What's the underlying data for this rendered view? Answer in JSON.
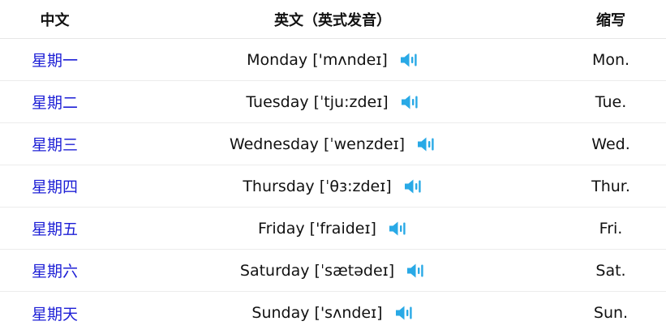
{
  "headers": {
    "chinese": "中文",
    "english": "英文（英式发音）",
    "abbreviation": "缩写"
  },
  "rows": [
    {
      "chinese": "星期一",
      "english": "Monday ['mʌndeɪ]",
      "abbr": "Mon."
    },
    {
      "chinese": "星期二",
      "english": "Tuesday [ˈtju:zdeɪ]",
      "abbr": "Tue."
    },
    {
      "chinese": "星期三",
      "english": "Wednesday [ˈwenzdeɪ]",
      "abbr": "Wed."
    },
    {
      "chinese": "星期四",
      "english": "Thursday [ˈθɜ:zdeɪ]",
      "abbr": "Thur."
    },
    {
      "chinese": "星期五",
      "english": "Friday ['fraideɪ]",
      "abbr": "Fri."
    },
    {
      "chinese": "星期六",
      "english": "Saturday [ˈsætədeɪ]",
      "abbr": "Sat."
    },
    {
      "chinese": "星期天",
      "english": "Sunday ['sʌndeɪ]",
      "abbr": "Sun."
    }
  ],
  "icons": {
    "audio": "speaker-icon"
  },
  "colors": {
    "link": "#1d1fd6",
    "speaker": "#29a9e6",
    "text": "#111111",
    "divider": "#ececec"
  }
}
